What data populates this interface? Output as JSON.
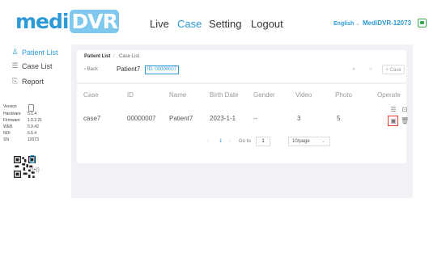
{
  "header": {
    "logo_part1": "medi",
    "logo_part2": "DVR",
    "nav": [
      "Live",
      "Case",
      "Setting",
      "Logout"
    ],
    "active_nav": "Case",
    "language": "English",
    "device": "MediDVR-12073",
    "accent_color": "#2c9ad6",
    "status_color": "#3aa84a"
  },
  "sidebar": {
    "items": [
      {
        "label": "Patient List",
        "icon": "person-icon",
        "active": true
      },
      {
        "label": "Case List",
        "icon": "list-icon",
        "active": false
      },
      {
        "label": "Report",
        "icon": "report-icon",
        "active": false
      }
    ],
    "info": [
      {
        "key": "Version",
        "value": ""
      },
      {
        "key": "Hardware",
        "value": "5.1.4"
      },
      {
        "key": "Firmware",
        "value": "1.0.2.21"
      },
      {
        "key": "WEB",
        "value": "5.9.42"
      },
      {
        "key": "NDI",
        "value": "5.5.4"
      },
      {
        "key": "SN",
        "value": "12073"
      }
    ]
  },
  "breadcrumb": {
    "root": "Patient List",
    "separator": "/",
    "current": "Case List"
  },
  "patient": {
    "back_label": "Back",
    "name": "Patient7",
    "id_label": "ID: 00000007"
  },
  "toolbar": {
    "add_case_label": "+ Case"
  },
  "table": {
    "headers": [
      "Case",
      "ID",
      "Name",
      "Birth Date",
      "Gender",
      "Video",
      "Photo",
      "Operate"
    ],
    "rows": [
      {
        "case": "case7",
        "id": "00000007",
        "name": "Patient7",
        "birth": "2023-1-1",
        "gender": "--",
        "video": "3",
        "photo": "5"
      }
    ]
  },
  "pagination": {
    "current_page": "1",
    "goto_label": "Go to",
    "goto_value": "1",
    "page_size": "10/page"
  }
}
